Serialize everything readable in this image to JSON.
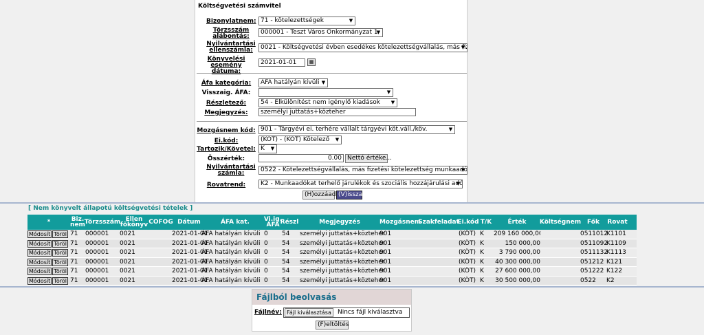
{
  "form": {
    "title": "Költségvetési számvitel",
    "bizonylatnem_label": "Bizonylatnem:",
    "bizonylatnem_value": "71 - kötelezettségek",
    "torzsszam_label_1": "Törzsszám",
    "torzsszam_label_2": "alábontás:",
    "torzsszam_value": "000001 - Teszt Város Önkormányzat 1",
    "nyilv_ellen_label_1": "Nyilvántartási",
    "nyilv_ellen_label_2": "ellenszámla:",
    "nyilv_ellen_value": "0021 - Költségvetési évben esedékes kötelezettségvállalás, más fiz",
    "konyv_datum_label_1": "Könyvelési",
    "konyv_datum_label_2": "esemény dátuma:",
    "konyv_datum_value": "2021-01-01",
    "afa_kat_label": "Áfa kategória:",
    "afa_kat_value": "ÁFA hatályán kívüli",
    "visszaig_label": "Visszaig. ÁFA:",
    "visszaig_value": "",
    "reszletezo_label": "Részletező:",
    "reszletezo_value": "54 - Elkülönítést nem igénylő kiadások",
    "megjegyzes_label": "Megjegyzés:",
    "megjegyzes_value": "személyi juttatás+közteher",
    "mozgasnem_label": "Mozgásnem kód:",
    "mozgasnem_value": "901 - Tárgyévi ei. terhére vállalt tárgyévi köt.váll./köv.",
    "eikod_label": "Ei.kód:",
    "eikod_value": "(KÖT) - (KÖT) Kötelező",
    "tartozik_label": "Tartozik/Követel:",
    "tartozik_value": "K",
    "osszertek_label": "Összérték:",
    "osszertek_value": "0.00",
    "netto_button": "Nettó értéke...",
    "nyilv_szamla_label_1": "Nyilvántartási",
    "nyilv_szamla_label_2": "számla:",
    "nyilv_szamla_value": "0522 - Kötelezettségvállalás, más fizetési kötelezettség munkaadók",
    "rovatrend_label": "Rovatrend:",
    "rovatrend_value": "K2 - Munkaadókat terhelő járulékok és szociális hozzájárulási adó",
    "hozzaad_button": "(H)ozzáad",
    "vissza_button": "(V)issza"
  },
  "table": {
    "title": "[ Nem könyvelt állapotú költségvetési tételek ]",
    "headers": {
      "star": "*",
      "biz": "Biz. nem",
      "torzsszam": "Törzsszám",
      "ellen": "Ellen főkönyv",
      "cofog": "COFOG",
      "datum": "Dátum",
      "afa": "ÁFA kat.",
      "viig": "Vi.ig. ÁFA",
      "reszl": "Részl",
      "megj": "Megjegyzés",
      "mozg": "Mozgásnem",
      "szakf": "Szakfeladat",
      "eikod": "Ei.kód",
      "tk": "T/K",
      "ertek": "Érték",
      "koltseg": "Költségnem",
      "fok": "Fők",
      "rovat": "Rovat"
    },
    "modosit_label": "Módosít",
    "torol_label": "Töröl",
    "rows": [
      {
        "biz": "71",
        "torzsszam": "000001",
        "ellen": "0021",
        "datum": "2021-01-01",
        "afa": "ÁFA hatályán kívüli",
        "viig": "0",
        "reszl": "54",
        "megj": "személyi juttatás+közteher",
        "mozg": "901",
        "eikod": "(KÖT)",
        "tk": "K",
        "ertek": "209 160 000,00",
        "fok": "0511012",
        "rovat": "K1101"
      },
      {
        "biz": "71",
        "torzsszam": "000001",
        "ellen": "0021",
        "datum": "2021-01-01",
        "afa": "ÁFA hatályán kívüli",
        "viig": "0",
        "reszl": "54",
        "megj": "személyi juttatás+közteher",
        "mozg": "901",
        "eikod": "(KÖT)",
        "tk": "K",
        "ertek": "150 000,00",
        "fok": "0511092",
        "rovat": "K1109"
      },
      {
        "biz": "71",
        "torzsszam": "000001",
        "ellen": "0021",
        "datum": "2021-01-01",
        "afa": "ÁFA hatályán kívüli",
        "viig": "0",
        "reszl": "54",
        "megj": "személyi juttatás+közteher",
        "mozg": "901",
        "eikod": "(KÖT)",
        "tk": "K",
        "ertek": "3 790 000,00",
        "fok": "0511132",
        "rovat": "K1113"
      },
      {
        "biz": "71",
        "torzsszam": "000001",
        "ellen": "0021",
        "datum": "2021-01-01",
        "afa": "ÁFA hatályán kívüli",
        "viig": "0",
        "reszl": "54",
        "megj": "személyi juttatás+közteher",
        "mozg": "901",
        "eikod": "(KÖT)",
        "tk": "K",
        "ertek": "40 300 000,00",
        "fok": "051212",
        "rovat": "K121"
      },
      {
        "biz": "71",
        "torzsszam": "000001",
        "ellen": "0021",
        "datum": "2021-01-01",
        "afa": "ÁFA hatályán kívüli",
        "viig": "0",
        "reszl": "54",
        "megj": "személyi juttatás+közteher",
        "mozg": "901",
        "eikod": "(KÖT)",
        "tk": "K",
        "ertek": "27 600 000,00",
        "fok": "051222",
        "rovat": "K122"
      },
      {
        "biz": "71",
        "torzsszam": "000001",
        "ellen": "0021",
        "datum": "2021-01-01",
        "afa": "ÁFA hatályán kívüli",
        "viig": "0",
        "reszl": "54",
        "megj": "személyi juttatás+közteher",
        "mozg": "901",
        "eikod": "(KÖT)",
        "tk": "K",
        "ertek": "30 500 000,00",
        "fok": "0522",
        "rovat": "K2"
      }
    ]
  },
  "file": {
    "title": "Fájlból beolvasás",
    "label": "Fájlnév:",
    "choose_button": "Fájl kiválasztása",
    "status": "Nincs fájl kiválasztva",
    "upload_button": "(F)eltöltés"
  },
  "colors": {
    "table_header": "#129c9c",
    "table_title": "#1a8c8c",
    "file_title": "#1a6e8c"
  }
}
